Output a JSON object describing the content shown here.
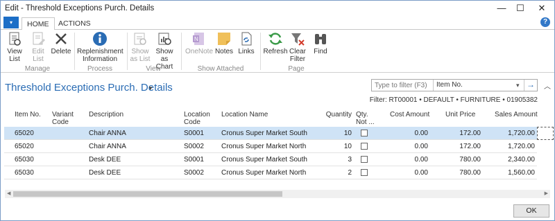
{
  "window": {
    "title": "Edit - Threshold Exceptions Purch. Details",
    "min": "—",
    "max": "☐",
    "close": "✕"
  },
  "ribbon": {
    "app_menu": "▾",
    "tabs": [
      "HOME",
      "ACTIONS"
    ],
    "help": "?",
    "buttons": {
      "view_list": "View List",
      "edit_list": "Edit List",
      "delete": "Delete",
      "replenishment": "Replenishment Information",
      "show_as_list": "Show as List",
      "show_as_chart": "Show as Chart",
      "onenote": "OneNote",
      "notes": "Notes",
      "links": "Links",
      "refresh": "Refresh",
      "clear_filter": "Clear Filter",
      "find": "Find"
    },
    "groups": [
      "Manage",
      "Process",
      "View",
      "Show Attached",
      "Page"
    ]
  },
  "page": {
    "title": "Threshold Exceptions Purch. Details"
  },
  "filter": {
    "placeholder": "Type to filter (F3)",
    "field": "Item No.",
    "summary": "Filter: RT00001 • DEFAULT • FURNITURE • 01905382"
  },
  "table": {
    "columns": [
      "Item No.",
      "Variant Code",
      "Description",
      "Location Code",
      "Location Name",
      "Quantity",
      "Qty. Not ...",
      "Cost Amount",
      "Unit Price",
      "Sales Amount"
    ],
    "rows": [
      {
        "item_no": "65020",
        "variant": "",
        "description": "Chair ANNA",
        "loc_code": "S0001",
        "loc_name": "Cronus Super Market South",
        "quantity": "10",
        "qty_not": false,
        "cost": "0.00",
        "unit_price": "172.00",
        "sales": "1,720.00"
      },
      {
        "item_no": "65020",
        "variant": "",
        "description": "Chair ANNA",
        "loc_code": "S0002",
        "loc_name": "Cronus Super Market North",
        "quantity": "10",
        "qty_not": false,
        "cost": "0.00",
        "unit_price": "172.00",
        "sales": "1,720.00"
      },
      {
        "item_no": "65030",
        "variant": "",
        "description": "Desk DEE",
        "loc_code": "S0001",
        "loc_name": "Cronus Super Market South",
        "quantity": "3",
        "qty_not": false,
        "cost": "0.00",
        "unit_price": "780.00",
        "sales": "2,340.00"
      },
      {
        "item_no": "65030",
        "variant": "",
        "description": "Desk DEE",
        "loc_code": "S0002",
        "loc_name": "Cronus Super Market North",
        "quantity": "2",
        "qty_not": false,
        "cost": "0.00",
        "unit_price": "780.00",
        "sales": "1,560.00"
      }
    ]
  },
  "footer": {
    "ok": "OK"
  },
  "colors": {
    "accent": "#2a6cb4",
    "selection": "#cfe3f6",
    "app_menu": "#1c6ec7"
  }
}
